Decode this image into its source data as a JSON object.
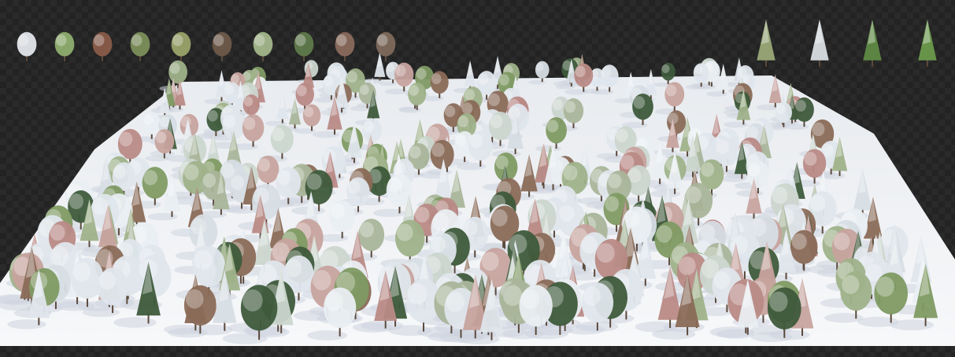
{
  "scene": {
    "background": "transparency-checkerboard",
    "colors": {
      "checker_dark": "#232323",
      "checker_light": "#2a2a2a",
      "ground_snow": "#f3f4f6",
      "shadow": "#cdd3de",
      "foliage_frost": "#dfe6ec",
      "foliage_green": "#7f9a63",
      "foliage_dark_green": "#3e5a3b",
      "foliage_rose": "#b98a86",
      "foliage_brown": "#8a6a57",
      "foliage_sage": "#a9b59a"
    },
    "objects": {
      "ground_plane": "snow-covered-plane",
      "forest": "mixed-frosted-forest",
      "sample_row_top_left": "broadleaf-tree-samples",
      "sample_row_top_right": "conifer-tree-samples"
    }
  }
}
